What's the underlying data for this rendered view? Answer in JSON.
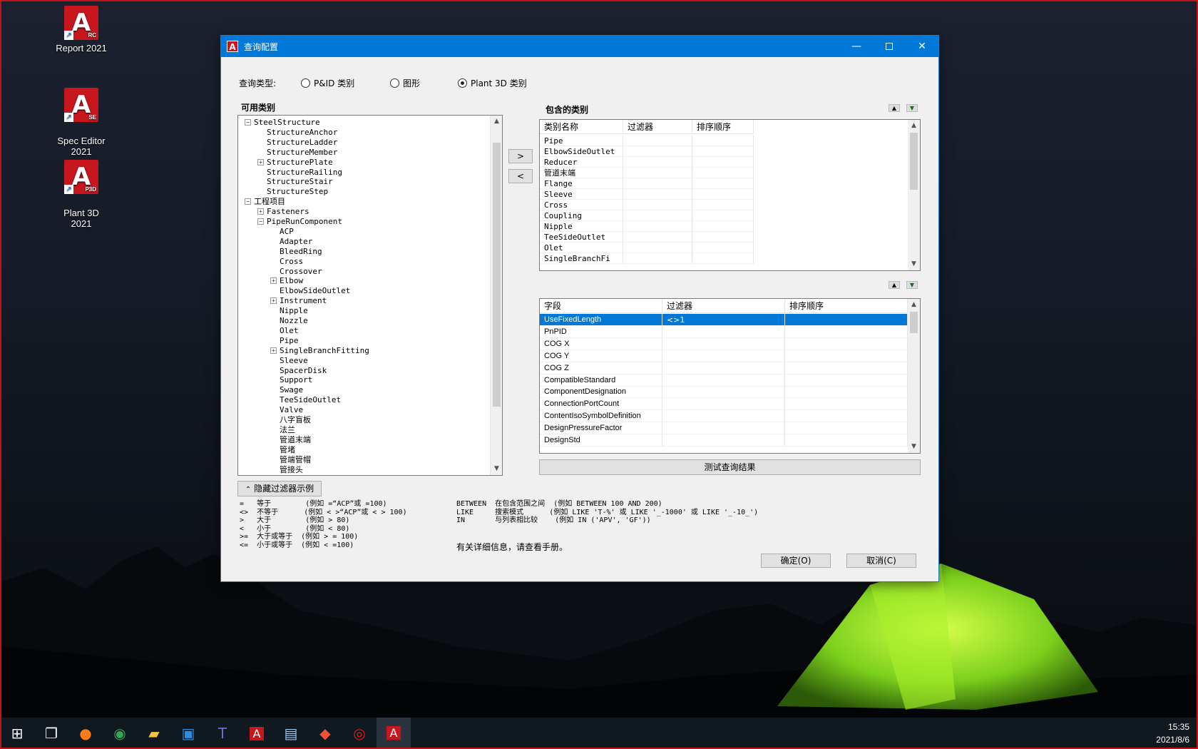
{
  "desktop": {
    "icons": [
      {
        "label": "Report 2021",
        "badge": "RC"
      },
      {
        "label": "Spec Editor\n2021",
        "badge": "SE"
      },
      {
        "label": "Plant 3D\n2021",
        "badge": "P3D"
      }
    ]
  },
  "dialog": {
    "title": "查询配置",
    "query_type_label": "查询类型:",
    "radios": [
      {
        "label": "P&ID 类别",
        "checked": false
      },
      {
        "label": "图形",
        "checked": false
      },
      {
        "label": "Plant 3D 类别",
        "checked": true
      }
    ],
    "available_label": "可用类别",
    "included_label": "包含的类别",
    "tree": [
      {
        "label": "SteelStructure",
        "level": 0,
        "exp": "-"
      },
      {
        "label": "StructureAnchor",
        "level": 1,
        "exp": ""
      },
      {
        "label": "StructureLadder",
        "level": 1,
        "exp": ""
      },
      {
        "label": "StructureMember",
        "level": 1,
        "exp": ""
      },
      {
        "label": "StructurePlate",
        "level": 1,
        "exp": "+"
      },
      {
        "label": "StructureRailing",
        "level": 1,
        "exp": ""
      },
      {
        "label": "StructureStair",
        "level": 1,
        "exp": ""
      },
      {
        "label": "StructureStep",
        "level": 1,
        "exp": ""
      },
      {
        "label": "工程项目",
        "level": 0,
        "exp": "-"
      },
      {
        "label": "Fasteners",
        "level": 1,
        "exp": "+"
      },
      {
        "label": "PipeRunComponent",
        "level": 1,
        "exp": "-"
      },
      {
        "label": "ACP",
        "level": 2,
        "exp": ""
      },
      {
        "label": "Adapter",
        "level": 2,
        "exp": ""
      },
      {
        "label": "BleedRing",
        "level": 2,
        "exp": ""
      },
      {
        "label": "Cross",
        "level": 2,
        "exp": ""
      },
      {
        "label": "Crossover",
        "level": 2,
        "exp": ""
      },
      {
        "label": "Elbow",
        "level": 2,
        "exp": "+"
      },
      {
        "label": "ElbowSideOutlet",
        "level": 2,
        "exp": ""
      },
      {
        "label": "Instrument",
        "level": 2,
        "exp": "+"
      },
      {
        "label": "Nipple",
        "level": 2,
        "exp": ""
      },
      {
        "label": "Nozzle",
        "level": 2,
        "exp": ""
      },
      {
        "label": "Olet",
        "level": 2,
        "exp": ""
      },
      {
        "label": "Pipe",
        "level": 2,
        "exp": ""
      },
      {
        "label": "SingleBranchFitting",
        "level": 2,
        "exp": "+"
      },
      {
        "label": "Sleeve",
        "level": 2,
        "exp": ""
      },
      {
        "label": "SpacerDisk",
        "level": 2,
        "exp": ""
      },
      {
        "label": "Support",
        "level": 2,
        "exp": ""
      },
      {
        "label": "Swage",
        "level": 2,
        "exp": ""
      },
      {
        "label": "TeeSideOutlet",
        "level": 2,
        "exp": ""
      },
      {
        "label": "Valve",
        "level": 2,
        "exp": ""
      },
      {
        "label": "八字盲板",
        "level": 2,
        "exp": ""
      },
      {
        "label": "法兰",
        "level": 2,
        "exp": ""
      },
      {
        "label": "管道末端",
        "level": 2,
        "exp": ""
      },
      {
        "label": "管堵",
        "level": 2,
        "exp": ""
      },
      {
        "label": "管端管帽",
        "level": 2,
        "exp": ""
      },
      {
        "label": "管接头",
        "level": 2,
        "exp": ""
      }
    ],
    "add_btn": ">",
    "remove_btn": "<",
    "included_grid": {
      "headers": [
        "类别名称",
        "过滤器",
        "排序顺序"
      ],
      "rows": [
        "Pipe",
        "ElbowSideOutlet",
        "Reducer",
        "管道末端",
        "Flange",
        "Sleeve",
        "Cross",
        "Coupling",
        "Nipple",
        "TeeSideOutlet",
        "Olet",
        "SingleBranchFi"
      ]
    },
    "field_grid": {
      "headers": [
        "字段",
        "过滤器",
        "排序顺序"
      ],
      "rows": [
        {
          "field": "UseFixedLength",
          "filter": "<>1"
        },
        {
          "field": "PnPID",
          "filter": ""
        },
        {
          "field": "COG X",
          "filter": ""
        },
        {
          "field": "COG Y",
          "filter": ""
        },
        {
          "field": "COG Z",
          "filter": ""
        },
        {
          "field": "CompatibleStandard",
          "filter": ""
        },
        {
          "field": "ComponentDesignation",
          "filter": ""
        },
        {
          "field": "ConnectionPortCount",
          "filter": ""
        },
        {
          "field": "ContentIsoSymbolDefinition",
          "filter": ""
        },
        {
          "field": "DesignPressureFactor",
          "filter": ""
        },
        {
          "field": "DesignStd",
          "filter": ""
        }
      ]
    },
    "test_btn": "测试查询结果",
    "hide_btn": "隐藏过滤器示例",
    "examples_left": [
      "=   等于        (例如 =“ACP”或 =100)",
      "<>  不等于      (例如 < >“ACP”或 < > 100)",
      ">   大于        (例如 > 80)",
      "<   小于        (例如 < 80)",
      ">=  大于或等于  (例如 > = 100)",
      "<=  小于或等于  (例如 < =100)"
    ],
    "examples_right": [
      "BETWEEN  在包含范围之间  (例如 BETWEEN 100 AND 200)",
      "LIKE     搜索模式      (例如 LIKE 'T-%' 或 LIKE '_-1000' 或 LIKE '_-10_')",
      "IN       与列表相比较    (例如 IN ('APV', 'GF'))"
    ],
    "manual_note": "有关详细信息，请查看手册。",
    "ok_btn": "确定(O)",
    "cancel_btn": "取消(C)"
  },
  "taskbar": {
    "time": "15:35",
    "date": "2021/8/6"
  }
}
